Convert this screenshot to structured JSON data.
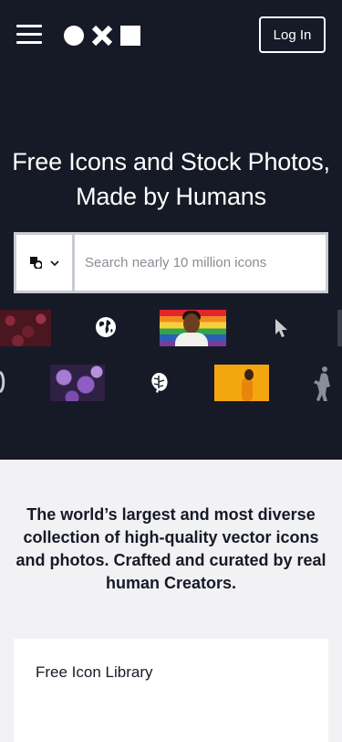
{
  "header": {
    "menu_icon": "hamburger-menu-icon",
    "logo_icon": "circle-x-square-logo",
    "login_label": "Log In"
  },
  "hero": {
    "title": "Free Icons and Stock Photos, Made by Humans",
    "background_color": "#161a26"
  },
  "search": {
    "type_icon": "shapes-icon",
    "type_dropdown_icon": "chevron-down-icon",
    "placeholder": "Search nearly 10 million icons",
    "value": ""
  },
  "showcase": {
    "row1": [
      "berries-photo",
      "globe-icon",
      "rainbow-flag-person-photo",
      "cursor-arrow-icon"
    ],
    "row2": [
      "purple-petunias-photo",
      "monstera-leaf-icon",
      "yellow-background-person-photo",
      "figure-silhouette-icon"
    ]
  },
  "tagline": "The world’s largest and most diverse collection of high-quality vector icons and photos. Crafted and curated by real human Creators.",
  "cards": [
    {
      "title": "Free Icon Library"
    }
  ],
  "colors": {
    "page_background": "#f2f2f5",
    "text_dark": "#161a26",
    "search_border": "#c8cbd2"
  }
}
